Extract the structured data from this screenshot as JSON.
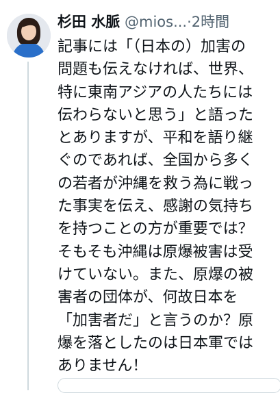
{
  "tweet": {
    "author_name": "杉田 水脈",
    "author_handle": "@mios...",
    "separator": "·",
    "time": "2時間",
    "avatar_icon": "user-avatar",
    "lines": [
      "記事には「（日本の）加害の",
      "問題も伝えなければ、世界、",
      "特に東南アジアの人たちには",
      "伝わらないと思う」と語った",
      "とありますが、平和を語り継",
      "ぐのであれば、全国から多く",
      "の若者が沖縄を救う為に戦っ",
      "た事実を伝え、感謝の気持ち",
      "を持つことの方が重要では？",
      "そもそも沖縄は原爆被害は受",
      "けていない。また、原爆の被",
      "害者の団体が、何故日本を",
      "「加害者だ」と言うのか？原",
      "爆を落としたのは日本軍では",
      "ありません！"
    ]
  }
}
